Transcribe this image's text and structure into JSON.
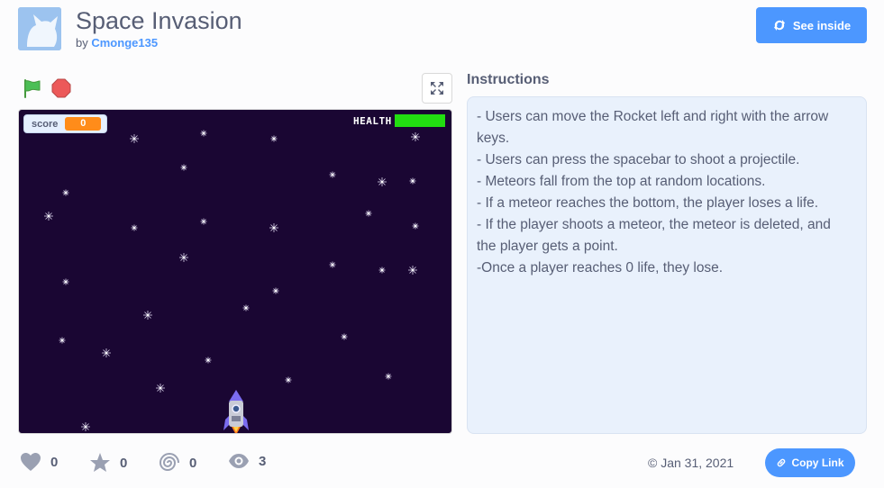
{
  "project": {
    "title": "Space Invasion",
    "by_prefix": "by",
    "author": "Cmonge135",
    "see_inside_label": "See inside"
  },
  "stage": {
    "score_label": "score",
    "score_value": "0",
    "health_label": "HEALTH",
    "health_level": 1.0
  },
  "instructions": {
    "heading": "Instructions",
    "lines": [
      "- Users can move the Rocket left and right with the arrow",
      "keys.",
      "- Users can press the spacebar to shoot a projectile.",
      "- Meteors fall from the top at random locations.",
      "- If a meteor reaches the bottom, the player loses a life.",
      "- If the player shoots a meteor, the meteor is deleted, and",
      "the player gets a point.",
      "-Once a player reaches 0 life, they lose."
    ]
  },
  "stats": {
    "loves": "0",
    "favorites": "0",
    "remixes": "0",
    "views": "3"
  },
  "date": "© Jan 31, 2021",
  "copy_link_label": "Copy Link",
  "colors": {
    "accent": "#4c97ff",
    "stage_bg": "#1a0633",
    "score_orange": "#ff8c1a",
    "health_green": "#22dd11",
    "instructions_bg": "#e9f1fc"
  },
  "icons": [
    "green-flag-icon",
    "stop-icon",
    "fullscreen-icon",
    "remix-arrows-icon",
    "heart-icon",
    "star-icon",
    "swirl-icon",
    "eye-icon",
    "link-icon",
    "scratch-cat-avatar"
  ]
}
